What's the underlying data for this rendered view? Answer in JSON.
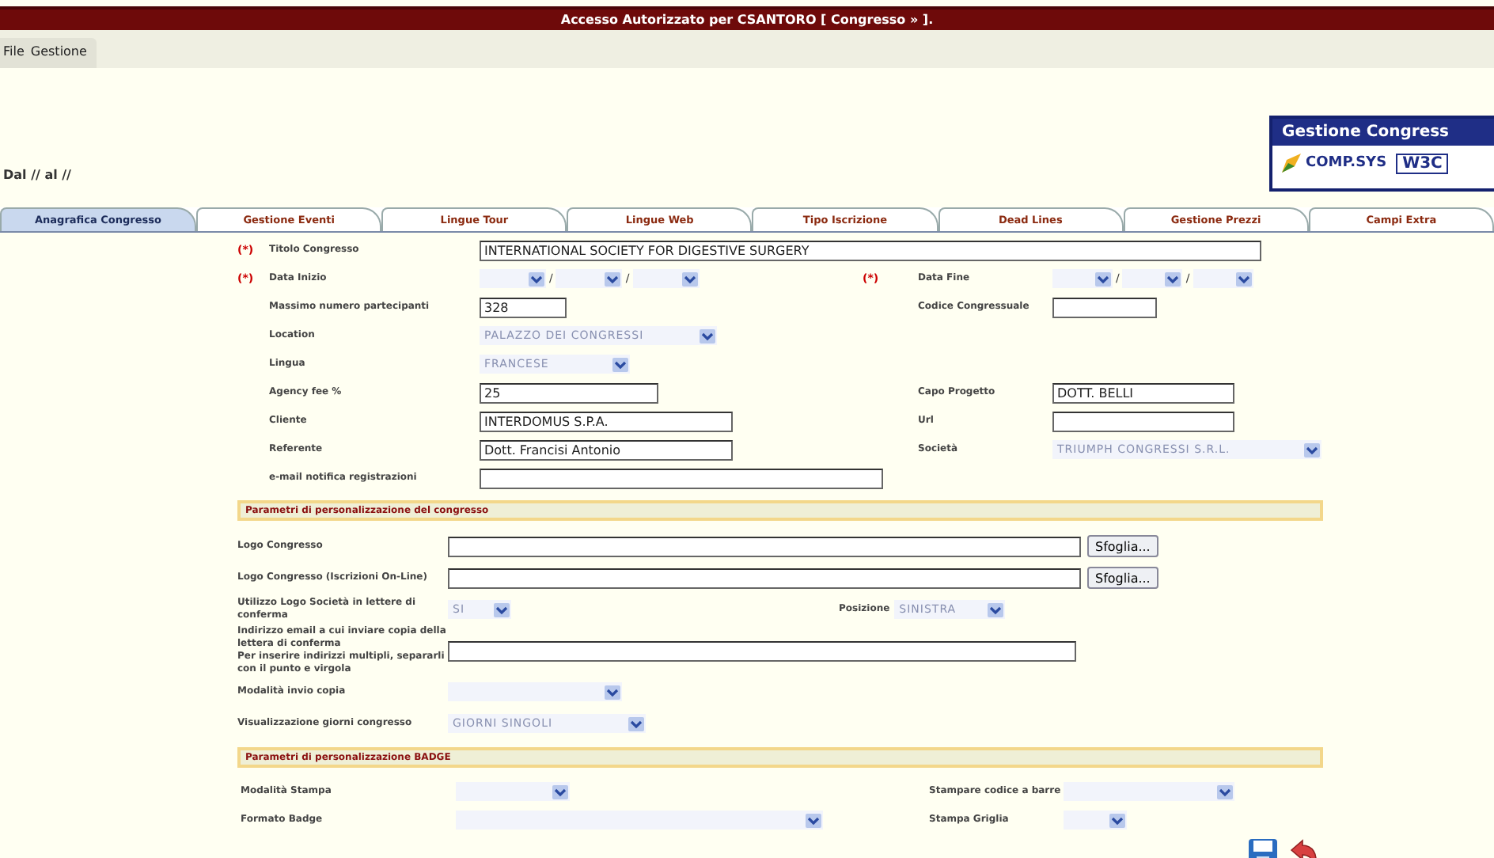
{
  "window": {
    "title": "Accesso Autorizzato per CSANTORO [ Congresso » ]."
  },
  "menu": [
    {
      "label": "File"
    },
    {
      "label": "Gestione"
    }
  ],
  "header": {
    "period": "Dal // al //",
    "logo": {
      "title": "Gestione Congress",
      "brand": "COMP.SYS",
      "badge": "W3C"
    }
  },
  "tabs": [
    {
      "label": "Anagrafica Congresso",
      "selected": true
    },
    {
      "label": "Gestione Eventi",
      "selected": false
    },
    {
      "label": "Lingue Tour",
      "selected": false
    },
    {
      "label": "Lingue Web",
      "selected": false
    },
    {
      "label": "Tipo Iscrizione",
      "selected": false
    },
    {
      "label": "Dead Lines",
      "selected": false
    },
    {
      "label": "Gestione Prezzi",
      "selected": false
    },
    {
      "label": "Campi Extra",
      "selected": false
    }
  ],
  "sections": [
    {
      "rows": [
        {
          "left": {
            "marker": "(*)",
            "label": "Titolo Congresso",
            "kind": "input",
            "value": "INTERNATIONAL SOCIETY FOR DIGESTIVE SURGERY"
          }
        },
        {
          "left": {
            "marker": "(*)",
            "label": "Data Inizio",
            "kind": "date",
            "separator": "/"
          },
          "right": {
            "marker": "(*)",
            "label": "Data Fine",
            "kind": "date",
            "separator": "/"
          }
        },
        {
          "left": {
            "label": "Massimo numero partecipanti",
            "kind": "input",
            "value": "328"
          },
          "right": {
            "label": "Codice Congressuale",
            "kind": "input"
          }
        },
        {
          "left": {
            "label": "Location",
            "kind": "select",
            "value": "PALAZZO DEI CONGRESSI"
          }
        },
        {
          "left": {
            "label": "Lingua",
            "kind": "select",
            "value": "FRANCESE"
          }
        },
        {
          "left": {
            "label": "Agency fee %",
            "kind": "input",
            "value": "25"
          },
          "right": {
            "label": "Capo Progetto",
            "kind": "input",
            "value": "DOTT. BELLI"
          }
        },
        {
          "left": {
            "label": "Cliente",
            "kind": "input",
            "value": "INTERDOMUS S.P.A."
          },
          "right": {
            "label": "Url",
            "kind": "input"
          }
        },
        {
          "left": {
            "label": "Referente",
            "kind": "input",
            "value": "Dott. Francisi Antonio"
          },
          "right": {
            "label": "Società",
            "kind": "select",
            "value": "TRIUMPH CONGRESSI S.R.L."
          }
        },
        {
          "left": {
            "label": "e-mail notifica registrazioni",
            "kind": "input"
          }
        }
      ]
    },
    {
      "title": "Parametri di personalizzazione del congresso",
      "rows": [
        {
          "left": {
            "label": "Logo Congresso",
            "kind": "file",
            "button": "Sfoglia..."
          }
        },
        {
          "left": {
            "label": "Logo Congresso (Iscrizioni On-Line)",
            "kind": "file",
            "button": "Sfoglia..."
          }
        },
        {
          "left": {
            "label": "Utilizzo Logo Società in lettere di conferma",
            "kind": "select",
            "value": "SI"
          },
          "right": {
            "label": "Posizione",
            "kind": "select",
            "value": "SINISTRA"
          }
        },
        {
          "left": {
            "label": "Indirizzo email a cui inviare copia della lettera di conferma",
            "note": "Per inserire indirizzi multipli, separarli con il punto e virgola",
            "kind": "input"
          }
        },
        {
          "left": {
            "label": "Modalità invio copia",
            "kind": "select"
          }
        },
        {
          "left": {
            "label": "Visualizzazione giorni congresso",
            "kind": "select",
            "value": "GIORNI SINGOLI"
          }
        }
      ]
    },
    {
      "title": "Parametri di personalizzazione BADGE",
      "rows": [
        {
          "left": {
            "label": "Modalità Stampa",
            "kind": "select"
          },
          "right": {
            "label": "Stampare codice a barre",
            "kind": "select"
          }
        },
        {
          "left": {
            "label": "Formato Badge",
            "kind": "select"
          },
          "right": {
            "label": "Stampa Griglia",
            "kind": "select"
          }
        }
      ]
    }
  ]
}
